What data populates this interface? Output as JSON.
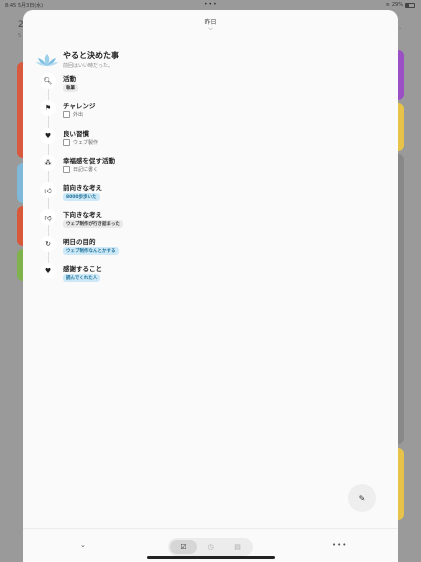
{
  "status_bar": {
    "time": "8:45",
    "date": "5月3日(水)",
    "dots": "•••",
    "battery": "29%"
  },
  "background_app": {
    "title_partial": "2",
    "sub_partial": "5",
    "more": "·"
  },
  "sheet": {
    "title": "昨日",
    "chevron": "⌵",
    "header": {
      "title": "やると決めた事",
      "subtitle": "前回はいい時だった。"
    },
    "items": [
      {
        "title": "活動",
        "kind": "tag",
        "tag_style": "gray",
        "value": "執筆",
        "icon": "magnifier-icon"
      },
      {
        "title": "チャレンジ",
        "kind": "check",
        "value": "外出",
        "icon": "flag-icon"
      },
      {
        "title": "良い習慣",
        "kind": "check",
        "value": "ウェブ製作",
        "icon": "heart-icon"
      },
      {
        "title": "幸福感を促す活動",
        "kind": "check",
        "value": "日記に書く",
        "icon": "people-icon"
      },
      {
        "title": "前向きな考え",
        "kind": "tag",
        "tag_style": "blue",
        "value": "8000歩歩いた",
        "icon": "thumbs-up-icon"
      },
      {
        "title": "下向きな考え",
        "kind": "tag",
        "tag_style": "gray",
        "value": "ウェブ制作が行き詰まった",
        "icon": "thumbs-down-icon"
      },
      {
        "title": "明日の目的",
        "kind": "tag",
        "tag_style": "blue",
        "value": "ウェブ制作なんとかする",
        "icon": "target-icon"
      },
      {
        "title": "感謝すること",
        "kind": "tag",
        "tag_style": "blue",
        "value": "読んでくれた人",
        "icon": "heart-filled-icon"
      }
    ],
    "fab_icon": "✎",
    "bottom": {
      "left_chevron": "⌄",
      "more": "•••",
      "segments": [
        "☑",
        "◷",
        "▤"
      ]
    }
  },
  "colors": {
    "accent_blue": "#cde9f8",
    "stripe_purple": "#9b4fc4",
    "stripe_yellow": "#e7c34a",
    "stripe_orange": "#e58a2d",
    "stripe_blue": "#7fb8d9",
    "stripe_red": "#d9583a",
    "stripe_green": "#7fb24a"
  }
}
